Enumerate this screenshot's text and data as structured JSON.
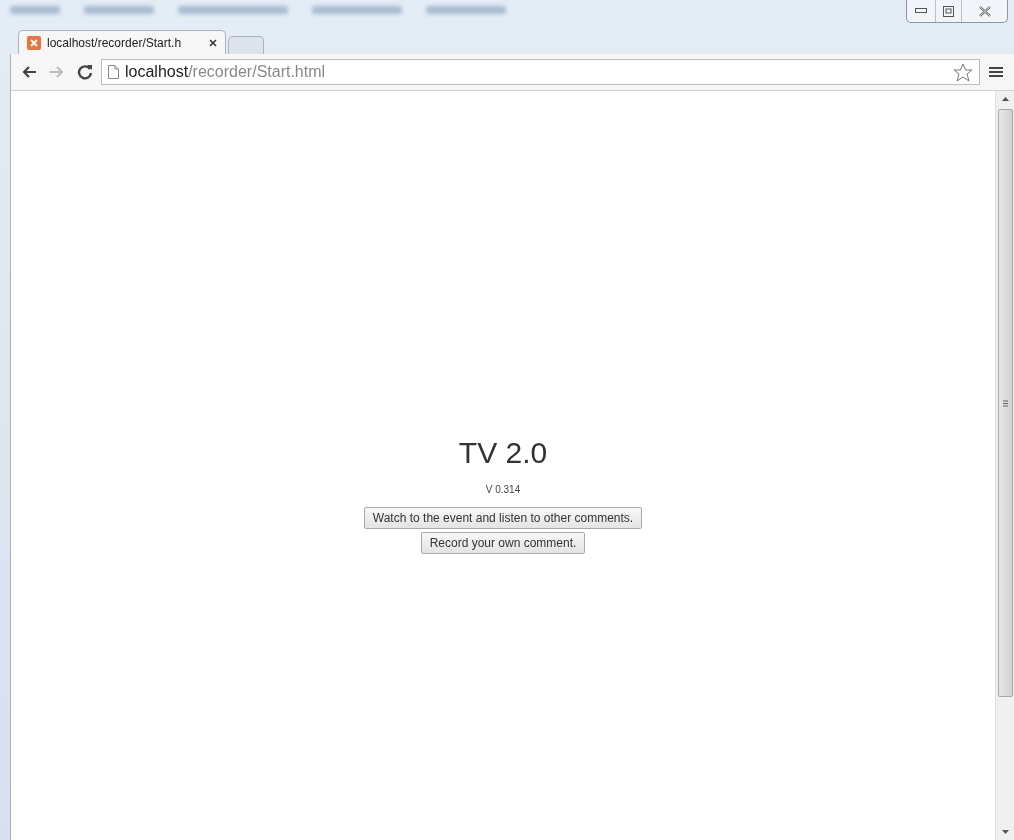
{
  "tabs": [
    {
      "label": "localhost/recorder/Start.h",
      "selected": true
    },
    {
      "selected": false
    }
  ],
  "address_bar": {
    "host": "localhost",
    "path": "/recorder/Start.html"
  },
  "page": {
    "title": "TV 2.0",
    "version": "V 0.314",
    "buttons": [
      "Watch to the event and listen to other comments.",
      "Record your own comment."
    ]
  }
}
